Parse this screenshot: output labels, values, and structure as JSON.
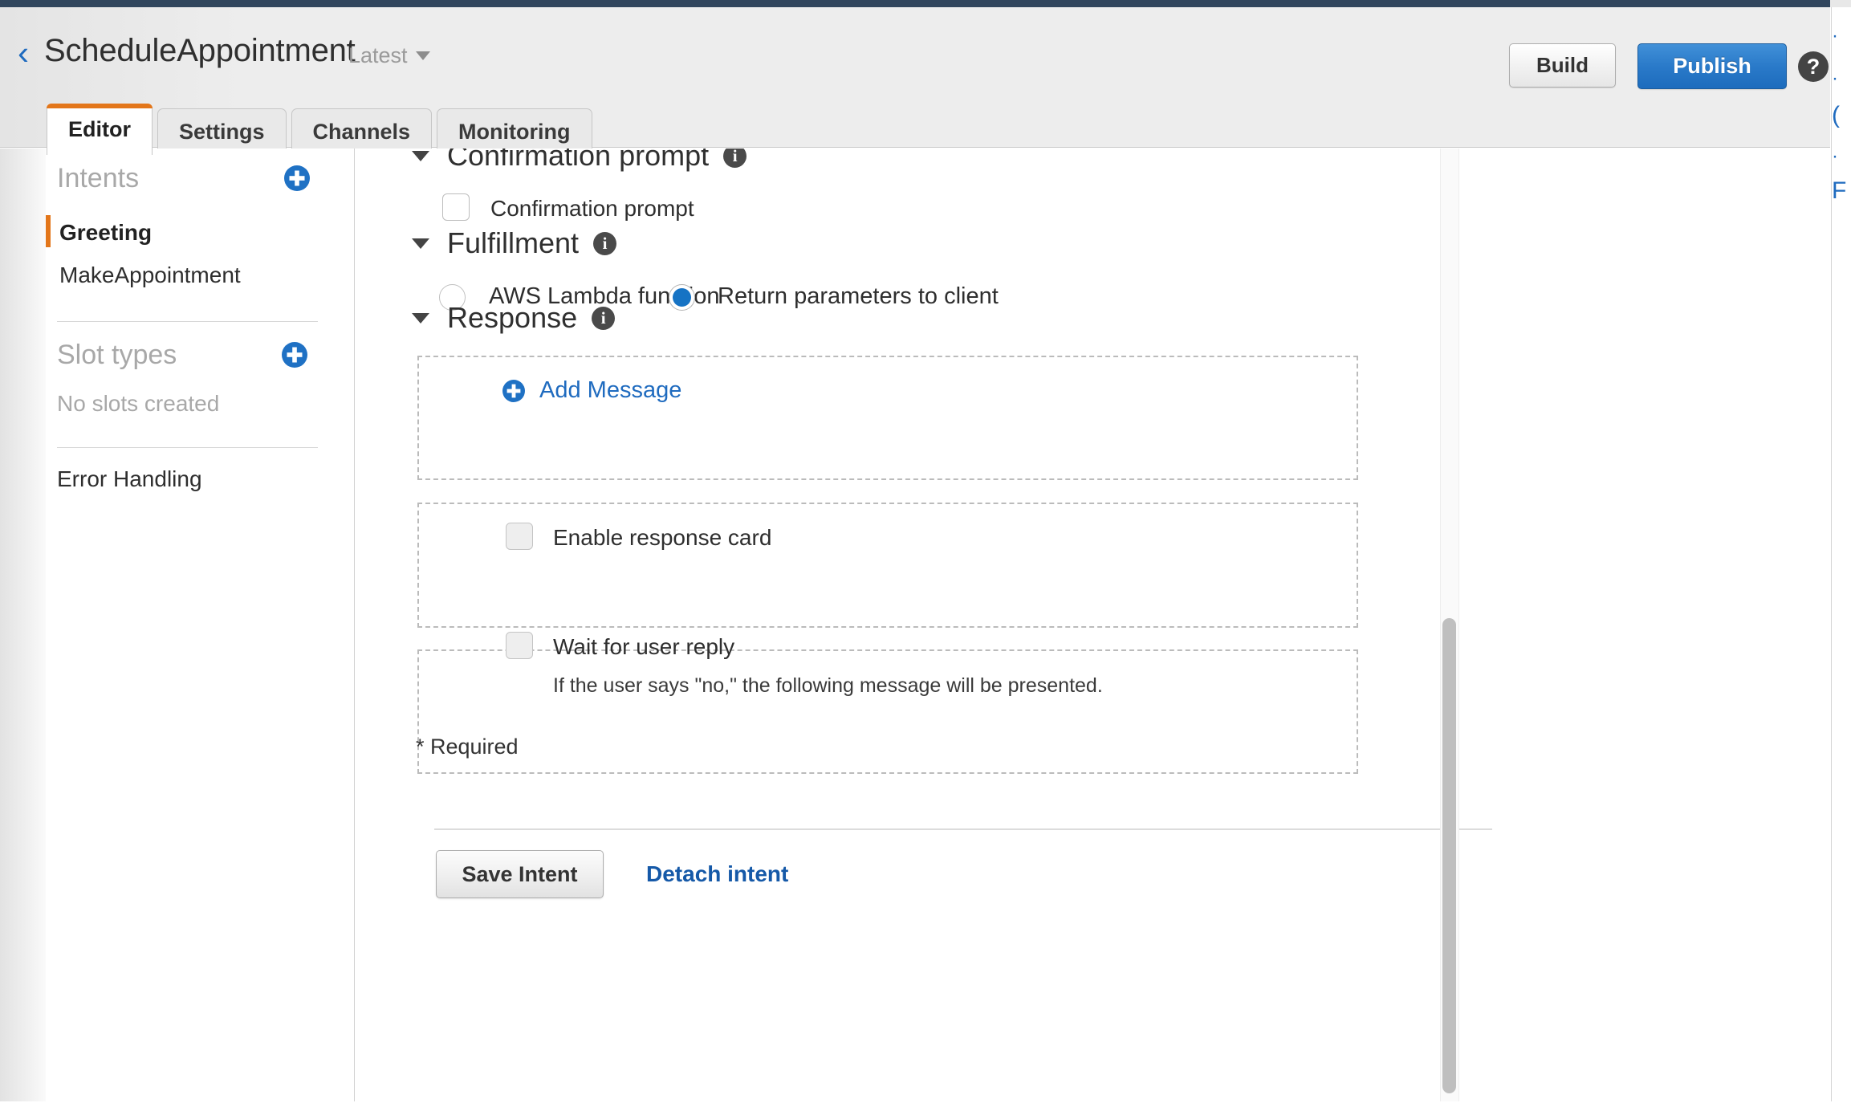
{
  "header": {
    "back_icon": "chevron-left-icon",
    "bot_name": "ScheduleAppointment",
    "version": "Latest",
    "build_label": "Build",
    "publish_label": "Publish",
    "help_label": "?",
    "accent_orange": "#e3761a",
    "accent_blue": "#1f6bbf",
    "publish_blue": "#2a7ac9",
    "top_strip_color": "#31465d"
  },
  "tabs": [
    {
      "label": "Editor",
      "active": true
    },
    {
      "label": "Settings",
      "active": false
    },
    {
      "label": "Channels",
      "active": false
    },
    {
      "label": "Monitoring",
      "active": false
    }
  ],
  "sidebar": {
    "intents_heading": "Intents",
    "intents_add_icon": "plus-circle-icon",
    "intents": [
      {
        "label": "Greeting",
        "selected": true
      },
      {
        "label": "MakeAppointment",
        "selected": false
      }
    ],
    "slot_types_heading": "Slot types",
    "slot_types_add_icon": "plus-circle-icon",
    "slot_types_empty": "No slots created",
    "error_handling": "Error Handling"
  },
  "main": {
    "confirmation_section": {
      "title": "Confirmation prompt",
      "info_icon": "info-icon",
      "caret_icon": "caret-down-icon",
      "checkbox_label": "Confirmation prompt",
      "checkbox_checked": false,
      "checkbox_disabled": false
    },
    "fulfillment_section": {
      "title": "Fulfillment",
      "info_icon": "info-icon",
      "caret_icon": "caret-down-icon",
      "options": [
        {
          "label": "AWS Lambda function",
          "selected": false
        },
        {
          "label": "Return parameters to client",
          "selected": true
        }
      ]
    },
    "response_section": {
      "title": "Response",
      "info_icon": "info-icon",
      "caret_icon": "caret-down-icon",
      "add_message_label": "Add Message",
      "add_message_icon": "plus-circle-icon",
      "response_card": {
        "label": "Enable response card",
        "checked": false,
        "disabled": true
      },
      "wait_for_reply": {
        "label": "Wait for user reply",
        "description": "If the user says \"no,\" the following message will be presented.",
        "checked": false,
        "disabled": true
      }
    },
    "required_note": "* Required",
    "save_label": "Save Intent",
    "detach_label": "Detach intent"
  },
  "right_panel": {
    "fragments": [
      "·",
      "·",
      "(",
      "·",
      "F"
    ]
  }
}
